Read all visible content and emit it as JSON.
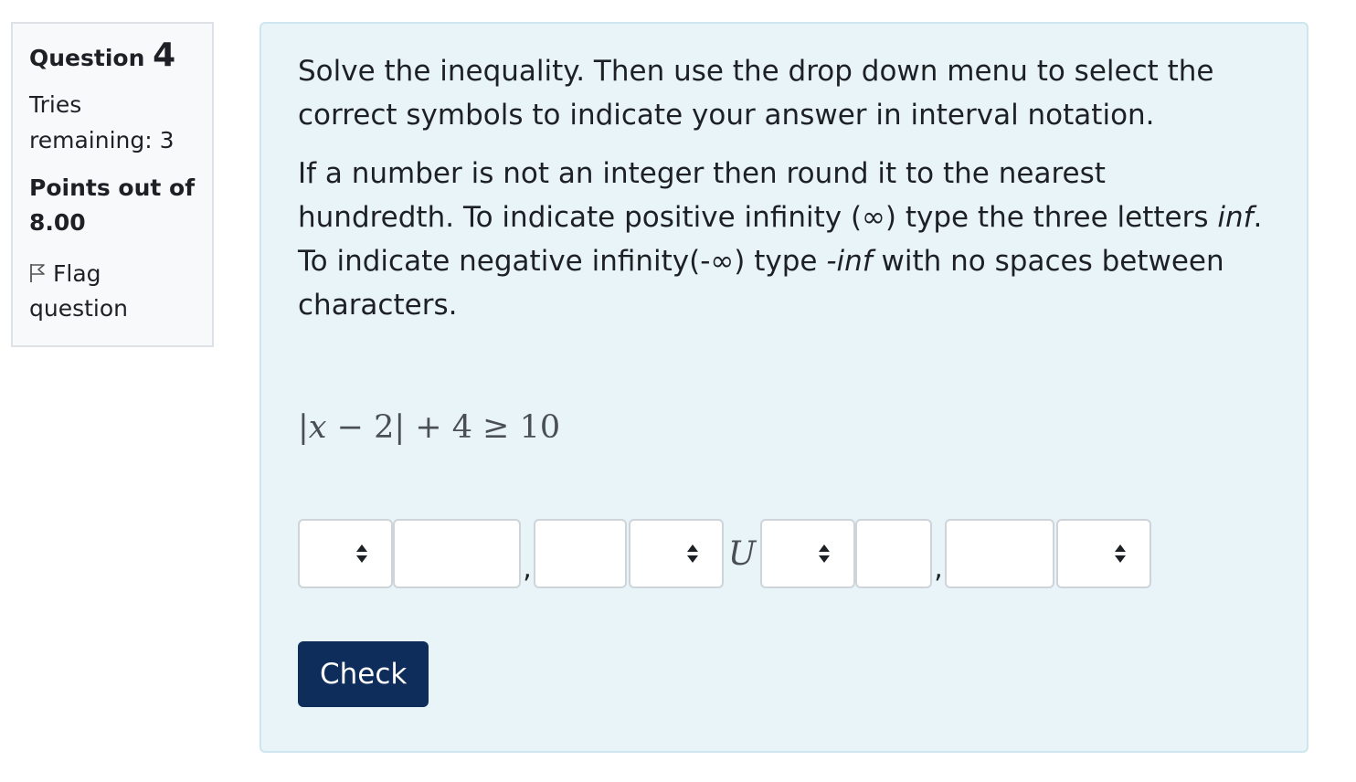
{
  "info": {
    "question_label": "Question",
    "question_number": "4",
    "tries": "Tries remaining: 3",
    "grade": "Points out of 8.00",
    "flag_label": "Flag question"
  },
  "question": {
    "para1": "Solve the inequality. Then use the drop down menu to select the correct symbols to indicate your answer in interval notation.",
    "p2_text1": "If a number is not an integer then round it to the nearest hundredth. To indicate positive infinity (∞) type the three letters ",
    "p2_em1": "inf",
    "p2_text2": ". To indicate negative infinity(-∞) type ",
    "p2_em2": "-inf",
    "p2_text3": " with no spaces between characters.",
    "math": {
      "left_bar": "|",
      "var": "x",
      "rest": " − 2| + 4 ≥ 10"
    }
  },
  "answer": {
    "separator_comma": ",",
    "union_symbol": "U",
    "inputs": [
      "",
      "",
      "",
      ""
    ]
  },
  "check_label": "Check",
  "colors": {
    "panel_bg": "#e8f4f7",
    "button_bg": "#0f2d5a"
  }
}
